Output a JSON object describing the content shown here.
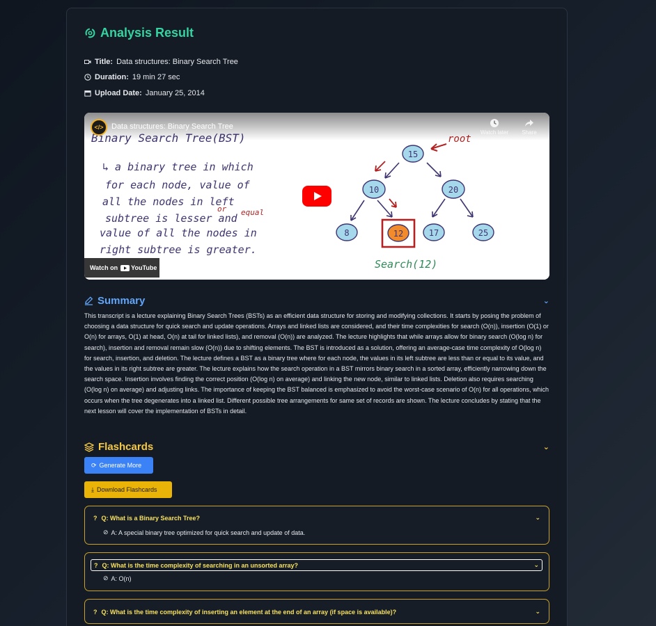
{
  "header": {
    "title": "Analysis Result"
  },
  "meta": {
    "title_label": "Title:",
    "title_value": "Data structures: Binary Search Tree",
    "duration_label": "Duration:",
    "duration_value": "19 min 27 sec",
    "upload_label": "Upload Date:",
    "upload_value": "January 25, 2014"
  },
  "video": {
    "title": "Data structures: Binary Search Tree",
    "channel_logo_text": "</>",
    "watch_later": "Watch later",
    "share": "Share",
    "watch_on": "Watch on",
    "youtube": "YouTube",
    "board": {
      "heading": "Binary Search Tree(BST)",
      "lines": [
        "↳ a binary tree in which",
        "for each node, value of",
        "all the nodes in left",
        "subtree is lesser and",
        "value of all the nodes in",
        "right subtree is greater."
      ],
      "insert_or": "or",
      "insert_equal": "equal",
      "root_label": "root",
      "nodes": [
        "15",
        "10",
        "20",
        "8",
        "12",
        "17",
        "25"
      ],
      "search_caption": "Search(12)"
    }
  },
  "summary": {
    "title": "Summary",
    "text": "This transcript is a lecture explaining Binary Search Trees (BSTs) as an efficient data structure for storing and modifying collections. It starts by posing the problem of choosing a data structure for quick search and update operations. Arrays and linked lists are considered, and their time complexities for search (O(n)), insertion (O(1) or O(n) for arrays, O(1) at head, O(n) at tail for linked lists), and removal (O(n)) are analyzed. The lecture highlights that while arrays allow for binary search (O(log n) for search), insertion and removal remain slow (O(n)) due to shifting elements. The BST is introduced as a solution, offering an average-case time complexity of O(log n) for search, insertion, and deletion. The lecture defines a BST as a binary tree where for each node, the values in its left subtree are less than or equal to its value, and the values in its right subtree are greater. The lecture explains how the search operation in a BST mirrors binary search in a sorted array, efficiently narrowing down the search space. Insertion involves finding the correct position (O(log n) on average) and linking the new node, similar to linked lists. Deletion also requires searching (O(log n) on average) and adjusting links. The importance of keeping the BST balanced is emphasized to avoid the worst-case scenario of O(n) for all operations, which occurs when the tree degenerates into a linked list. Different possible tree arrangements for same set of records are shown. The lecture concludes by stating that the next lesson will cover the implementation of BSTs in detail."
  },
  "flashcards": {
    "title": "Flashcards",
    "generate_label": "Generate More",
    "download_label": "Download Flashcards",
    "items": [
      {
        "q": "Q: What is a Binary Search Tree?",
        "a": "A: A special binary tree optimized for quick search and update of data."
      },
      {
        "q": "Q: What is the time complexity of searching in an unsorted array?",
        "a": "A: O(n)"
      },
      {
        "q": "Q: What is the time complexity of inserting an element at the end of an array (if space is available)?",
        "a": ""
      }
    ]
  },
  "colors": {
    "accent_green": "#35d3a1",
    "summary_blue": "#60a5fa",
    "flash_yellow": "#f6c945",
    "button_blue": "#3b82f6",
    "button_yellow": "#eab308",
    "card_border": "#c9a227"
  }
}
